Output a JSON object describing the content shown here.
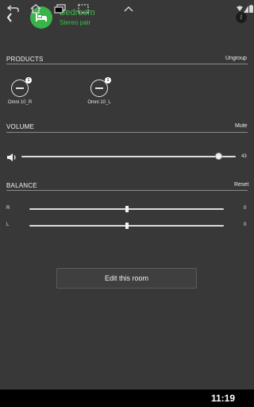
{
  "header": {
    "room_name": "Bedroom",
    "room_subtitle": "Stereo pair",
    "room_icon": "bed-icon",
    "accent": "#3dbd4c"
  },
  "products": {
    "title": "PRODUCTS",
    "action": "Ungroup",
    "items": [
      {
        "name": "Omni 10_R",
        "badge": "1",
        "icon": "speaker-icon"
      },
      {
        "name": "Omni 10_L",
        "badge": "1",
        "icon": "speaker-icon"
      }
    ]
  },
  "volume": {
    "title": "VOLUME",
    "action": "Mute",
    "value": "43",
    "level": 0.92
  },
  "balance": {
    "title": "BALANCE",
    "action": "Reset",
    "rows": [
      {
        "label": "R",
        "value": "0",
        "level": 0.5
      },
      {
        "label": "L",
        "value": "0",
        "level": 0.5
      }
    ]
  },
  "edit_button": {
    "label": "Edit this room"
  },
  "statusbar": {
    "time": "11:19"
  }
}
